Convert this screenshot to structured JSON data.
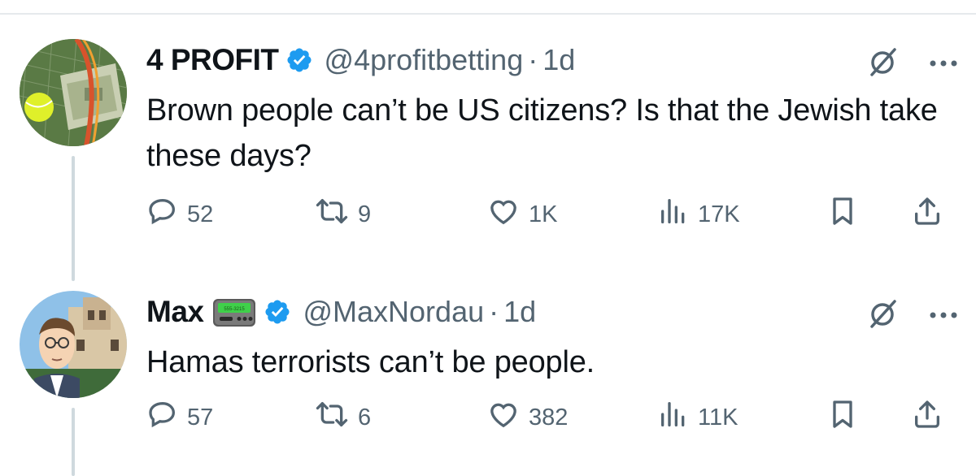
{
  "tweets": [
    {
      "author": {
        "name": "4 PROFIT",
        "handle": "@4profitbetting",
        "time": "1d",
        "verified": true
      },
      "text": "Brown people can’t be US citizens? Is that the Jewish take these days?",
      "stats": {
        "replies": "52",
        "retweets": "9",
        "likes": "1K",
        "views": "17K"
      },
      "avatar_icon": "tennis-ball-money-avatar"
    },
    {
      "author": {
        "name": "Max",
        "handle": "@MaxNordau",
        "time": "1d",
        "verified": true,
        "emoji": "pager-emoji",
        "pager_text": "555-3215"
      },
      "text": "Hamas terrorists can’t be people.",
      "stats": {
        "replies": "57",
        "retweets": "6",
        "likes": "382",
        "views": "11K"
      },
      "avatar_icon": "cartoon-man-avatar"
    }
  ],
  "separator": "·",
  "icons": {
    "reply": "reply-icon",
    "retweet": "retweet-icon",
    "like": "heart-icon",
    "views": "views-icon",
    "bookmark": "bookmark-icon",
    "share": "share-icon",
    "grok": "grok-icon",
    "more": "more-icon"
  },
  "colors": {
    "text": "#0f1419",
    "secondary": "#536471",
    "verified": "#1d9bf0",
    "thread_line": "#cfd9de"
  }
}
